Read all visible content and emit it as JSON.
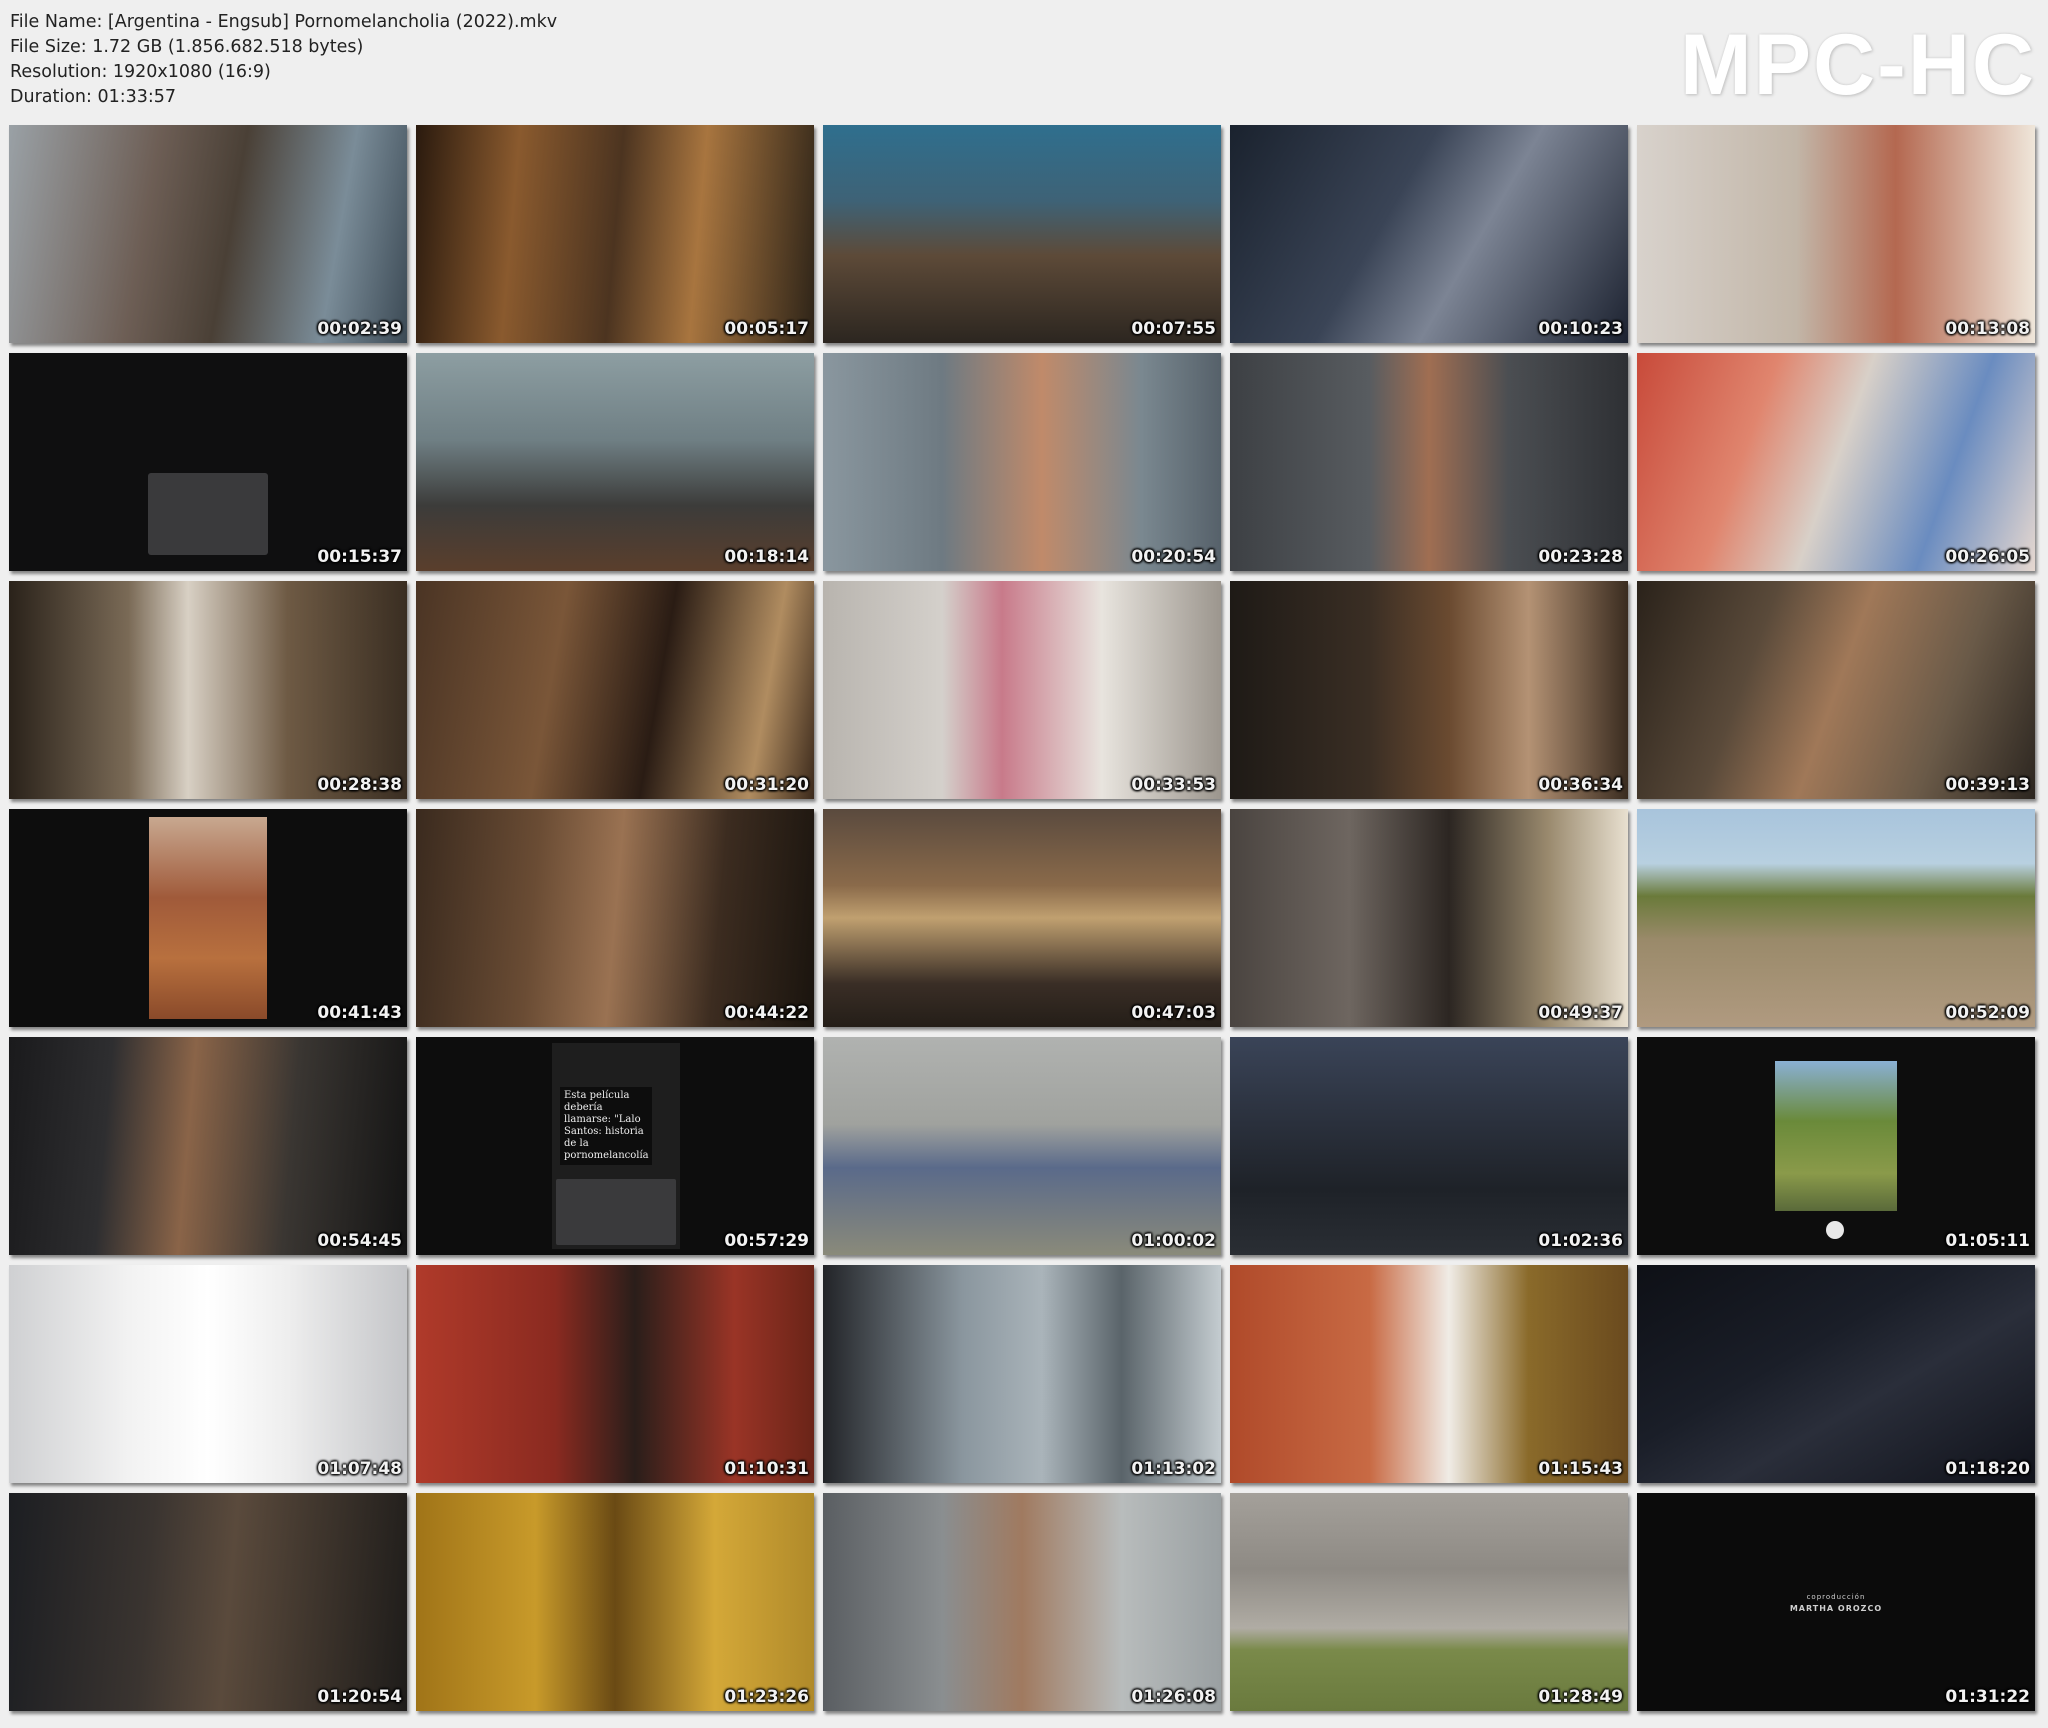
{
  "info": {
    "file_name": "File Name: [Argentina - Engsub] Pornomelancholia (2022).mkv",
    "file_size": "File Size: 1.72 GB (1.856.682.518 bytes)",
    "resolution": "Resolution: 1920x1080 (16:9)",
    "duration": "Duration: 01:33:57"
  },
  "logo": "MPC-HC",
  "thumbnails": [
    {
      "ts": "00:02:39",
      "bg": "linear-gradient(100deg,#9aa1a6 0%,#6d5e55 35%,#4a4036 55%,#7a8c98 80%,#3c4a55 100%)"
    },
    {
      "ts": "00:05:17",
      "bg": "linear-gradient(95deg,#2a1a0e 0%,#8a5a2e 25%,#4c3420 50%,#a8753f 70%,#2e2418 100%)"
    },
    {
      "ts": "00:07:55",
      "bg": "linear-gradient(180deg,#2f6f8e 0%,#3e6276 35%,#5d4a38 60%,#2c2620 100%)"
    },
    {
      "ts": "00:10:23",
      "bg": "linear-gradient(120deg,#1a222e 0%,#3a4456 40%,#7c8494 60%,#1c2230 100%)"
    },
    {
      "ts": "00:13:08",
      "bg": "linear-gradient(90deg,#d8d2cc 0%,#c2b6a8 40%,#b46850 65%,#efe6da 100%)"
    },
    {
      "ts": "00:15:37",
      "bg": "#0f0f10",
      "kind": "phone-keyboard"
    },
    {
      "ts": "00:18:14",
      "bg": "linear-gradient(180deg,#8d9ea2 0%,#6f7f84 40%,#3c3c3a 70%,#5a3e2c 100%)"
    },
    {
      "ts": "00:20:54",
      "bg": "linear-gradient(90deg,#8a979f 0%,#6e7a82 30%,#c08a6a 55%,#7a8890 80%,#56616a 100%)"
    },
    {
      "ts": "00:23:28",
      "bg": "linear-gradient(90deg,#3d4044 0%,#585c60 35%,#a06e52 50%,#4b4e52 70%,#2e3034 100%)"
    },
    {
      "ts": "00:26:05",
      "bg": "linear-gradient(110deg,#c84a3a 0%,#e0856e 30%,#d8d0c8 50%,#6a8cc0 75%,#e6d8d0 100%)"
    },
    {
      "ts": "00:28:38",
      "bg": "linear-gradient(90deg,#2a221a 0%,#7a6a56 30%,#d8d0c4 45%,#6e5a44 70%,#3a2e22 100%)"
    },
    {
      "ts": "00:31:20",
      "bg": "linear-gradient(100deg,#4a3424 0%,#7a5638 35%,#2a1c14 60%,#b08c60 85%,#3c2a1c 100%)"
    },
    {
      "ts": "00:33:53",
      "bg": "linear-gradient(90deg,#b8b4ae 0%,#d4d0cb 30%,#c87a8a 45%,#e8e4de 70%,#9c968e 100%)"
    },
    {
      "ts": "00:36:34",
      "bg": "linear-gradient(90deg,#1e1a16 0%,#3a2e24 35%,#6a4a30 55%,#b49274 75%,#3a2c20 100%)"
    },
    {
      "ts": "00:39:13",
      "bg": "linear-gradient(110deg,#2a221a 0%,#5a4a3a 30%,#a07858 50%,#6a5a48 75%,#2c2620 100%)"
    },
    {
      "ts": "00:41:43",
      "bg": "#0d0d0d",
      "kind": "vertical-clip"
    },
    {
      "ts": "00:44:22",
      "bg": "linear-gradient(95deg,#3a2a1e 0%,#6a4c34 30%,#9a7252 50%,#3c2c20 75%,#1a140e 100%)"
    },
    {
      "ts": "00:47:03",
      "bg": "linear-gradient(180deg,#5a4a3e 0%,#8a6a4a 35%,#c0a070 50%,#3a2e26 80%,#241e18 100%)"
    },
    {
      "ts": "00:49:37",
      "bg": "linear-gradient(90deg,#4a4440 0%,#6e6660 30%,#2c2622 55%,#9a8a6e 80%,#e8e0d0 100%)"
    },
    {
      "ts": "00:52:09",
      "bg": "linear-gradient(180deg,#a8c4dc 0%,#b8d0e0 25%,#6a7a3a 40%,#9a8a6a 60%,#b09a80 100%)"
    },
    {
      "ts": "00:54:45",
      "bg": "linear-gradient(95deg,#1a1a1c 0%,#2e2e30 25%,#8a6448 45%,#3a3632 70%,#141414 100%)"
    },
    {
      "ts": "00:57:29",
      "bg": "#0d0d0d",
      "kind": "phone-caption",
      "caption": "Esta película debería llamarse: \"Lalo Santos: historia de la pornomelancolía"
    },
    {
      "ts": "01:00:02",
      "bg": "linear-gradient(180deg,#b0b2b0 0%,#a0a29e 40%,#5a6a8a 60%,#8a8a7a 100%)"
    },
    {
      "ts": "01:02:36",
      "bg": "linear-gradient(180deg,#3a4458 0%,#2a303c 40%,#1e2228 70%,#2a2e34 100%)"
    },
    {
      "ts": "01:05:11",
      "bg": "#0d0d0d",
      "kind": "camera-ui"
    },
    {
      "ts": "01:07:48",
      "bg": "linear-gradient(90deg,#cfd0d2 0%,#f2f2f2 30%,#ffffff 50%,#eeeeee 70%,#c4c5c8 100%)"
    },
    {
      "ts": "01:10:31",
      "bg": "linear-gradient(90deg,#b03a2a 0%,#8a2a20 35%,#2a1e1a 55%,#9a3426 80%,#6a2418 100%)"
    },
    {
      "ts": "01:13:02",
      "bg": "linear-gradient(90deg,#222428 0%,#8a969e 35%,#aab4ba 55%,#5a646a 75%,#c4ccd0 100%)"
    },
    {
      "ts": "01:15:43",
      "bg": "linear-gradient(90deg,#b04a2a 0%,#c86a44 35%,#f0ece6 55%,#8a6a2a 75%,#6a4a1e 100%)"
    },
    {
      "ts": "01:18:20",
      "bg": "linear-gradient(150deg,#0e1016 0%,#1a1e28 40%,#2a2e3a 60%,#10121a 100%)"
    },
    {
      "ts": "01:20:54",
      "bg": "linear-gradient(95deg,#1c1e22 0%,#3a3430 35%,#5a4a3c 55%,#1e1c1a 100%)"
    },
    {
      "ts": "01:23:26",
      "bg": "linear-gradient(90deg,#a07418 0%,#c89a2a 30%,#6a4a14 50%,#d4a838 75%,#b08a2a 100%)"
    },
    {
      "ts": "01:26:08",
      "bg": "linear-gradient(90deg,#5a5e62 0%,#8a8e90 30%,#a07a60 50%,#b8bcbc 75%,#9aa0a2 100%)"
    },
    {
      "ts": "01:28:49",
      "bg": "linear-gradient(180deg,#a4a09a 0%,#8e8a84 35%,#b0aca4 62%,#7a8a4a 72%,#6a7a3e 100%)"
    },
    {
      "ts": "01:31:22",
      "bg": "#0b0b0b",
      "kind": "credit",
      "credit_line1": "coproducción",
      "credit_line2": "MARTHA OROZCO"
    }
  ]
}
